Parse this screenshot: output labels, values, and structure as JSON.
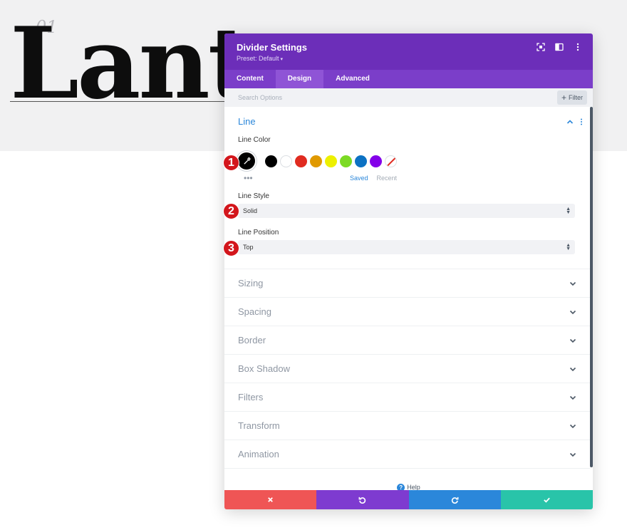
{
  "background": {
    "number": "01",
    "title": "Lant"
  },
  "modal": {
    "title": "Divider Settings",
    "preset": "Preset: Default",
    "tabs": [
      {
        "label": "Content",
        "active": false
      },
      {
        "label": "Design",
        "active": true
      },
      {
        "label": "Advanced",
        "active": false
      }
    ],
    "search_placeholder": "Search Options",
    "filter_label": "Filter",
    "line_section": {
      "title": "Line",
      "line_color_label": "Line Color",
      "selected_color": "#000000",
      "swatches": [
        "#000000",
        "#ffffff",
        "#e02b20",
        "#e09900",
        "#edf000",
        "#7cda24",
        "#0c71c3",
        "#8300e9",
        "none"
      ],
      "saved_label": "Saved",
      "recent_label": "Recent",
      "line_style_label": "Line Style",
      "line_style_value": "Solid",
      "line_position_label": "Line Position",
      "line_position_value": "Top"
    },
    "collapsed_sections": [
      "Sizing",
      "Spacing",
      "Border",
      "Box Shadow",
      "Filters",
      "Transform",
      "Animation"
    ],
    "help_label": "Help"
  },
  "markers": [
    "1",
    "2",
    "3"
  ],
  "colors": {
    "header": "#6c2eb9",
    "tabs": "#7b3ec9",
    "accent_blue": "#2b87da",
    "cancel": "#ef5555",
    "undo": "#7e3bd0",
    "redo": "#2b87da",
    "save": "#29c4a9",
    "marker": "#d3161c"
  }
}
